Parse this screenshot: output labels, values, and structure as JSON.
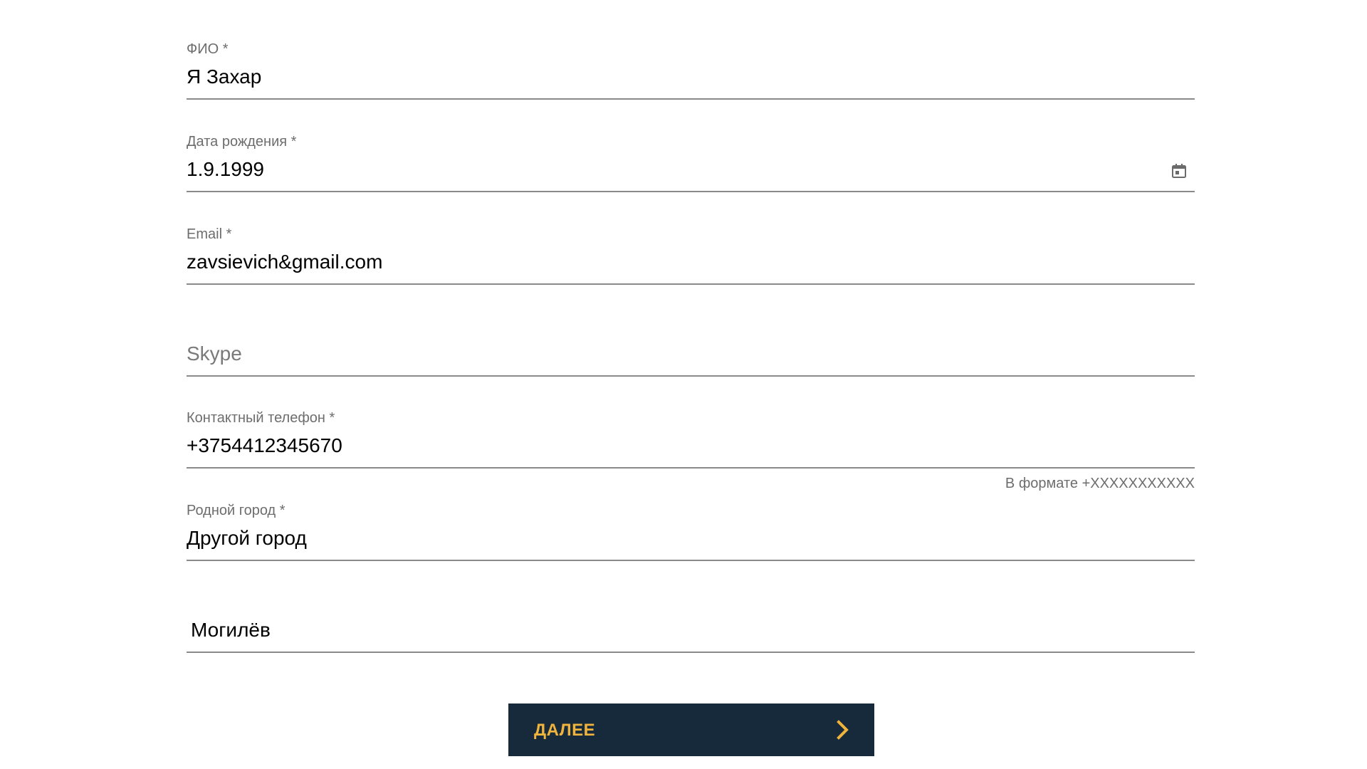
{
  "form": {
    "full_name": {
      "label": "ФИО *",
      "value": "Я Захар"
    },
    "birth_date": {
      "label": "Дата рождения *",
      "value": "1.9.1999",
      "icon": "calendar-icon"
    },
    "email": {
      "label": "Email *",
      "value": "zavsievich&gmail.com"
    },
    "skype": {
      "placeholder": "Skype",
      "value": ""
    },
    "phone": {
      "label": "Контактный телефон *",
      "value": "+3754412345670",
      "hint": "В формате +XXXXXXXXXXX"
    },
    "home_city": {
      "label": "Родной город *",
      "value": "Другой город"
    },
    "other_city": {
      "value": "Могилёв"
    }
  },
  "next_button": {
    "label": "ДАЛЕЕ",
    "icon": "chevron-right-icon"
  },
  "colors": {
    "button_background": "#172a3c",
    "button_text": "#f0b43c",
    "label": "#6d6d6d",
    "underline": "#8a8a8a"
  }
}
